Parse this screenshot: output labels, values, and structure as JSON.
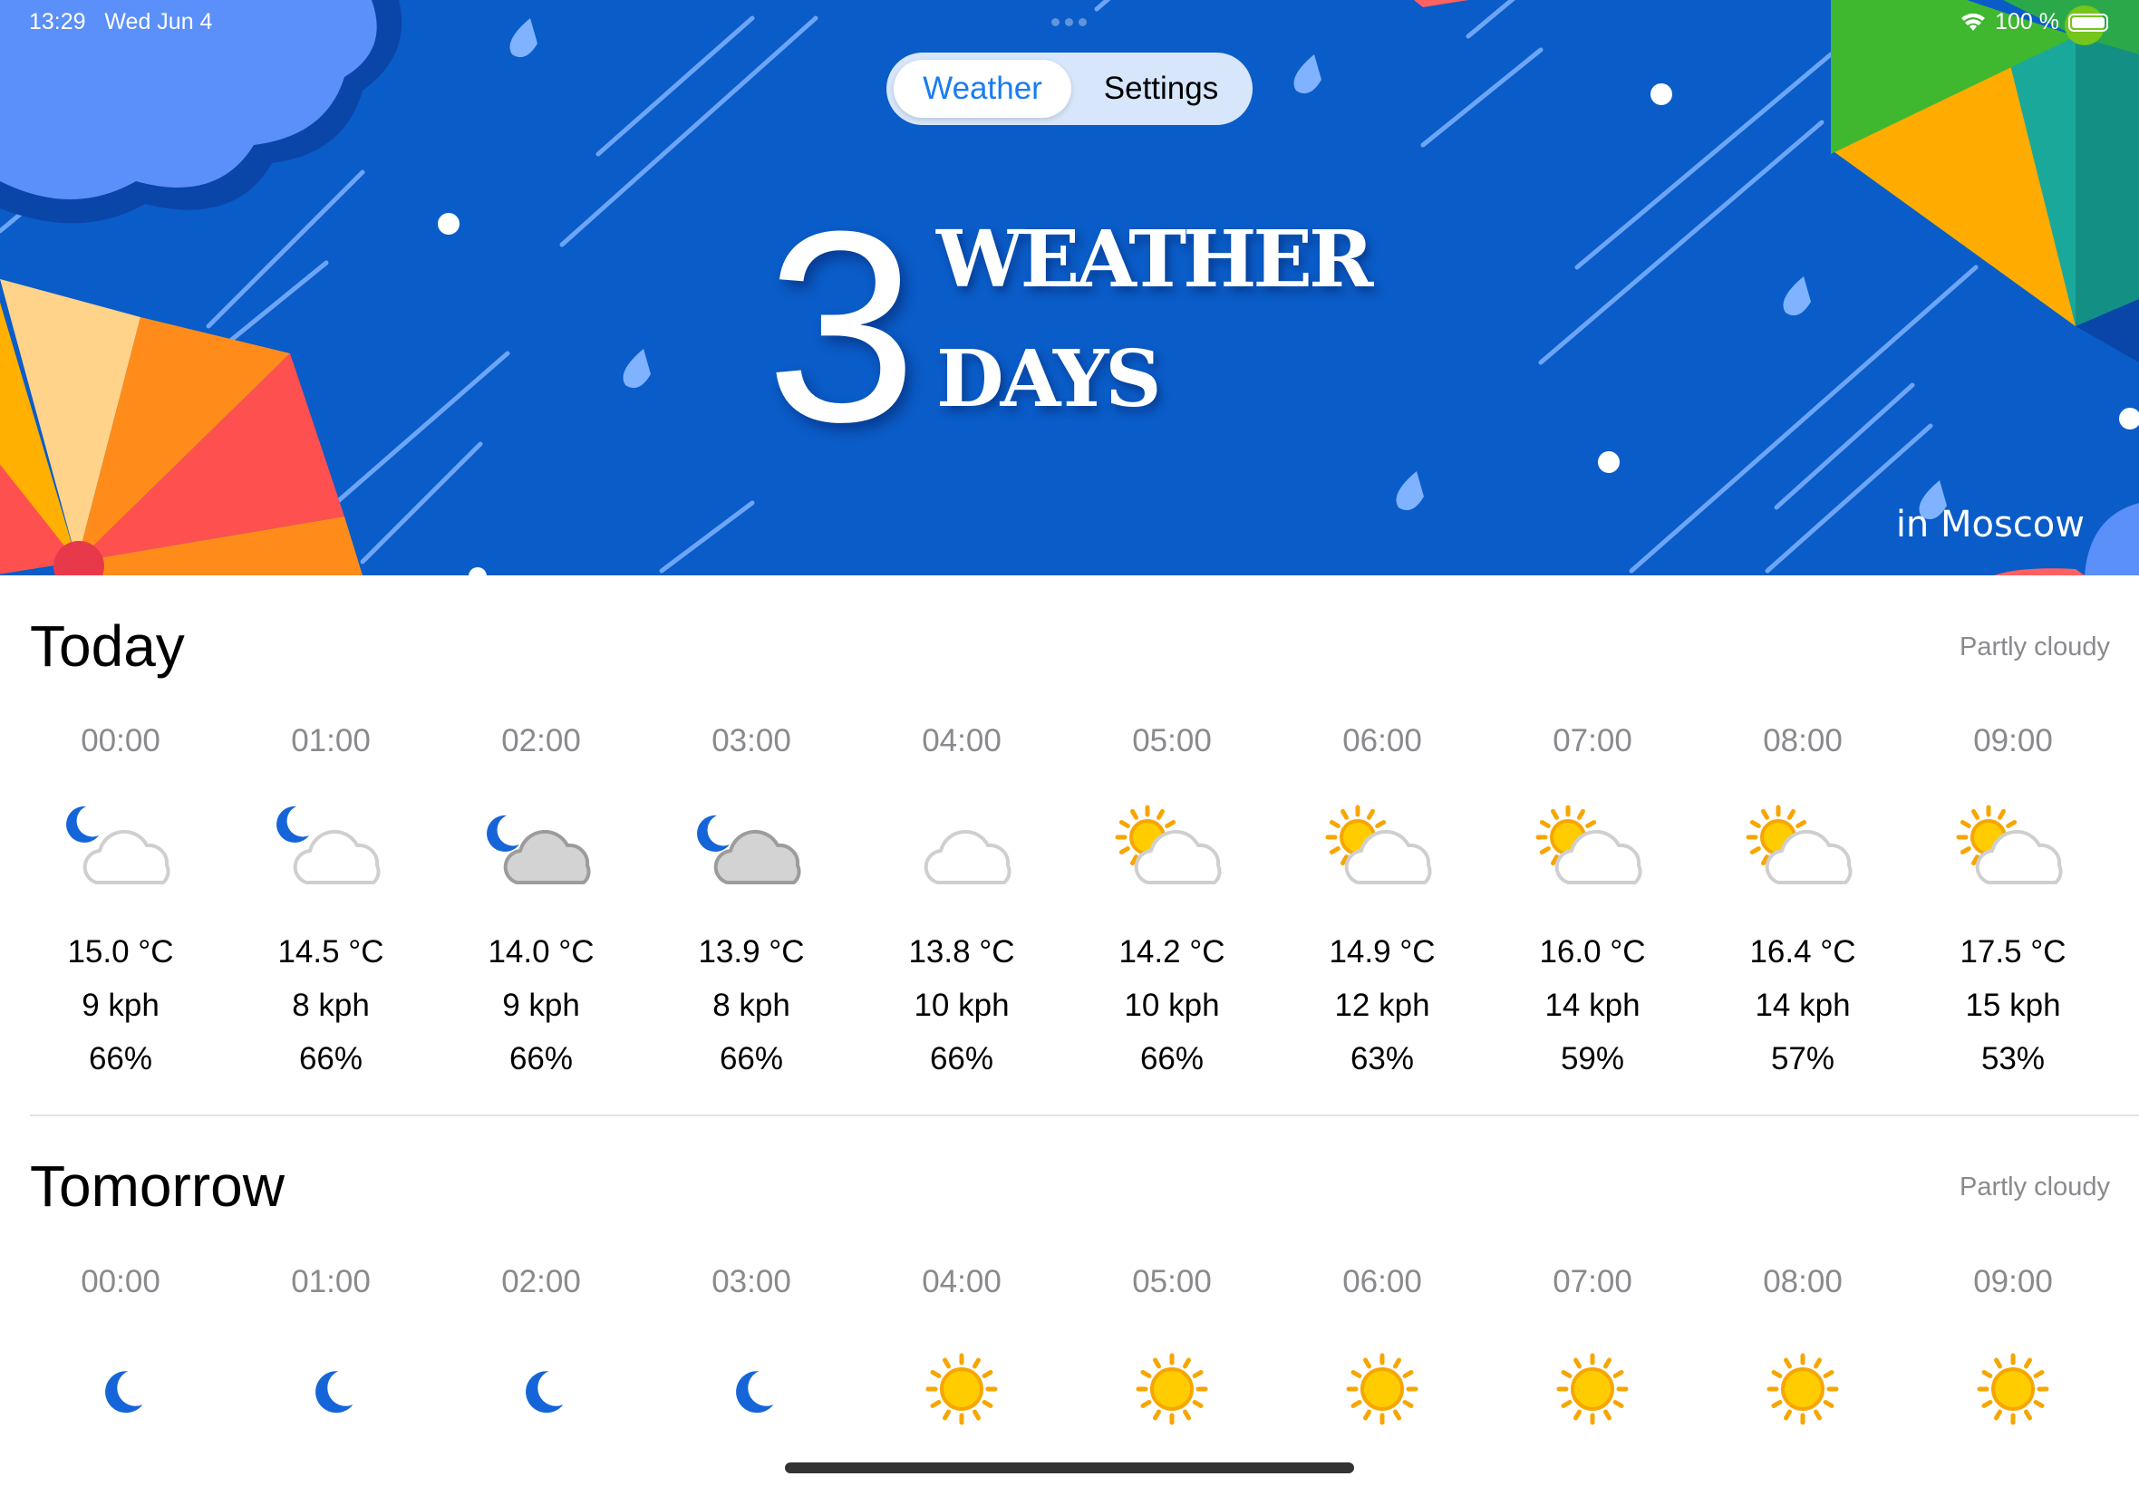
{
  "status_bar": {
    "time": "13:29",
    "date": "Wed Jun 4",
    "battery": "100 %"
  },
  "tabs": {
    "weather": "Weather",
    "settings": "Settings"
  },
  "hero": {
    "number": "3",
    "line1": "WEATHER",
    "line2": "DAYS",
    "city": "in Moscow"
  },
  "colors": {
    "hero_bg": "#0a5cc8",
    "accent": "#1a7cf2"
  },
  "today": {
    "title": "Today",
    "condition": "Partly cloudy",
    "hours": [
      {
        "time": "00:00",
        "icon": "moon-cloud-icon",
        "temp": "15.0 °C",
        "wind": "9 kph",
        "humidity": "66%"
      },
      {
        "time": "01:00",
        "icon": "moon-cloud-icon",
        "temp": "14.5 °C",
        "wind": "8 kph",
        "humidity": "66%"
      },
      {
        "time": "02:00",
        "icon": "moon-grey-cloud-icon",
        "temp": "14.0 °C",
        "wind": "9 kph",
        "humidity": "66%"
      },
      {
        "time": "03:00",
        "icon": "moon-grey-cloud-icon",
        "temp": "13.9 °C",
        "wind": "8 kph",
        "humidity": "66%"
      },
      {
        "time": "04:00",
        "icon": "cloud-icon",
        "temp": "13.8 °C",
        "wind": "10 kph",
        "humidity": "66%"
      },
      {
        "time": "05:00",
        "icon": "sun-cloud-icon",
        "temp": "14.2 °C",
        "wind": "10 kph",
        "humidity": "66%"
      },
      {
        "time": "06:00",
        "icon": "sun-cloud-icon",
        "temp": "14.9 °C",
        "wind": "12 kph",
        "humidity": "63%"
      },
      {
        "time": "07:00",
        "icon": "sun-cloud-icon",
        "temp": "16.0 °C",
        "wind": "14 kph",
        "humidity": "59%"
      },
      {
        "time": "08:00",
        "icon": "sun-cloud-icon",
        "temp": "16.4 °C",
        "wind": "14 kph",
        "humidity": "57%"
      },
      {
        "time": "09:00",
        "icon": "sun-cloud-icon",
        "temp": "17.5 °C",
        "wind": "15 kph",
        "humidity": "53%"
      }
    ]
  },
  "tomorrow": {
    "title": "Tomorrow",
    "condition": "Partly cloudy",
    "hours": [
      {
        "time": "00:00",
        "icon": "moon-icon"
      },
      {
        "time": "01:00",
        "icon": "moon-icon"
      },
      {
        "time": "02:00",
        "icon": "moon-icon"
      },
      {
        "time": "03:00",
        "icon": "moon-icon"
      },
      {
        "time": "04:00",
        "icon": "sun-icon"
      },
      {
        "time": "05:00",
        "icon": "sun-icon"
      },
      {
        "time": "06:00",
        "icon": "sun-icon"
      },
      {
        "time": "07:00",
        "icon": "sun-icon"
      },
      {
        "time": "08:00",
        "icon": "sun-icon"
      },
      {
        "time": "09:00",
        "icon": "sun-icon"
      }
    ]
  }
}
